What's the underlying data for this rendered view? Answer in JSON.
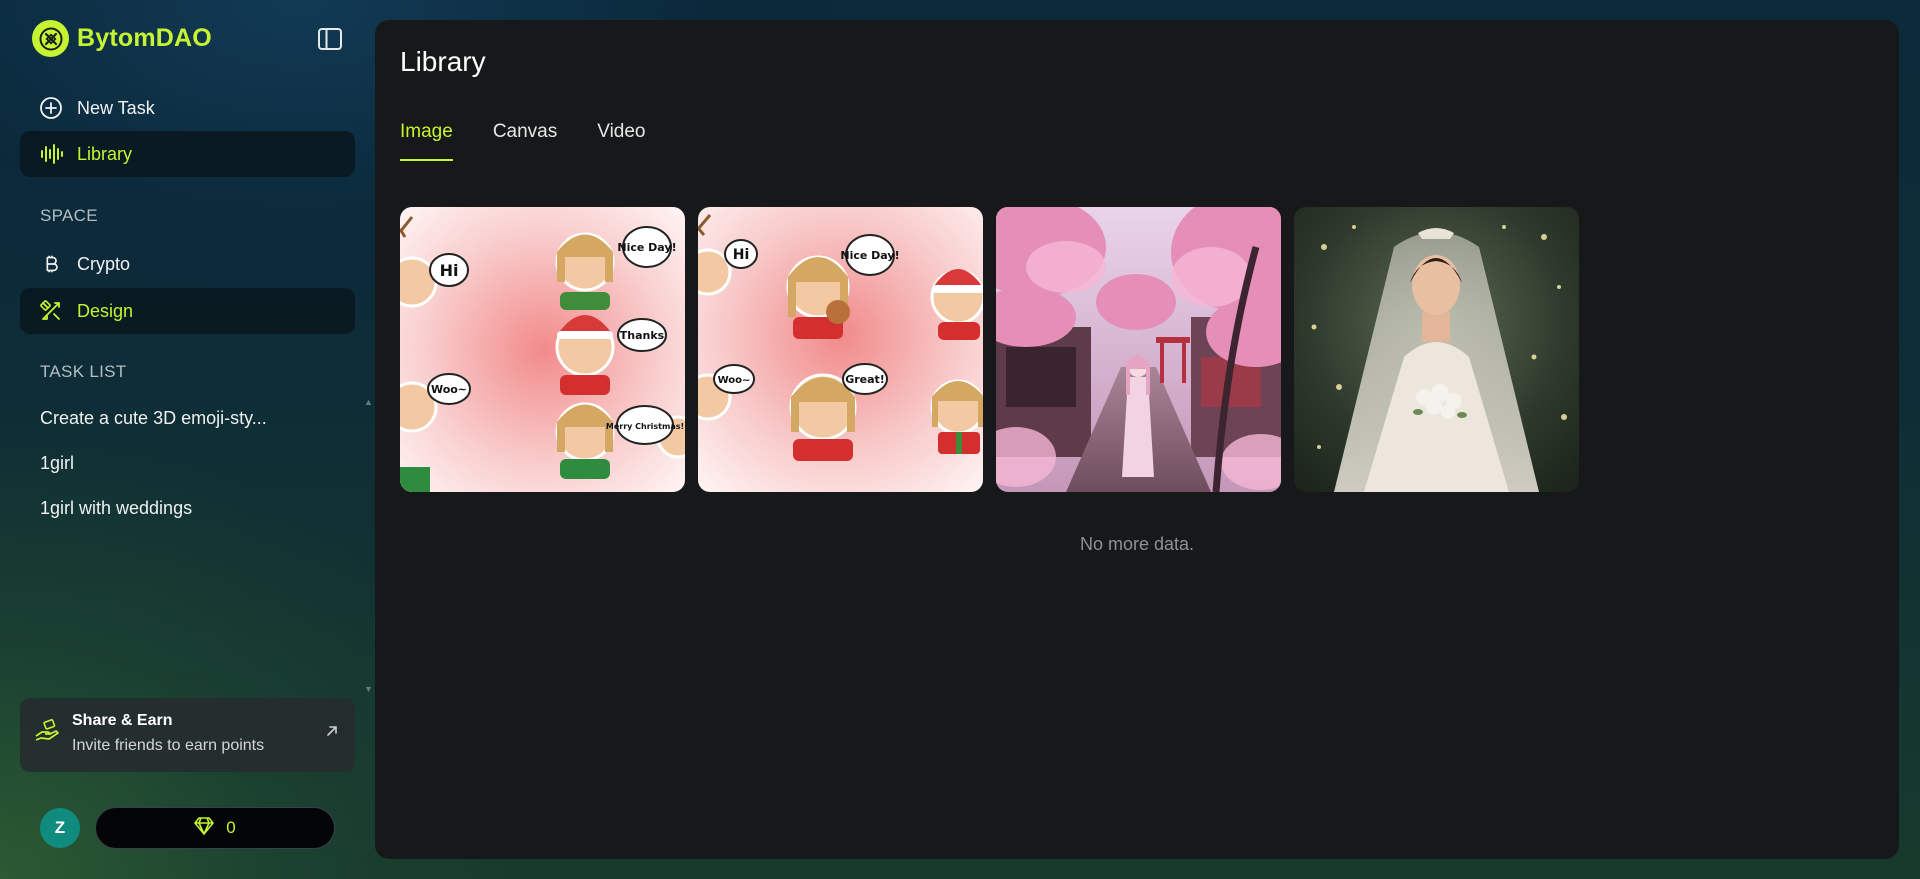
{
  "brand": {
    "name": "BytomDAO",
    "accent": "#c6f432"
  },
  "nav": {
    "new_task": "New Task",
    "library": "Library"
  },
  "space": {
    "label": "SPACE",
    "items": [
      {
        "label": "Crypto",
        "icon": "bitcoin-icon"
      },
      {
        "label": "Design",
        "icon": "design-tools-icon"
      }
    ]
  },
  "task_list": {
    "label": "TASK LIST",
    "items": [
      "Create a cute 3D emoji-sty...",
      "1girl",
      "1girl with weddings"
    ]
  },
  "share": {
    "title": "Share & Earn",
    "subtitle": "Invite friends to earn points"
  },
  "user": {
    "initial": "Z",
    "points": "0"
  },
  "main": {
    "title": "Library",
    "tabs": [
      "Image",
      "Canvas",
      "Video"
    ],
    "active_tab": "Image",
    "footer": "No more data."
  },
  "gallery": [
    {
      "bubbles": [
        "Hi",
        "Nice Day!",
        "Thanks",
        "Woo~",
        "Merry Christmas!"
      ]
    },
    {
      "bubbles": [
        "Hi",
        "Nice Day!",
        "Woo~",
        "Great!"
      ]
    },
    {
      "bubbles": []
    },
    {
      "bubbles": []
    }
  ]
}
